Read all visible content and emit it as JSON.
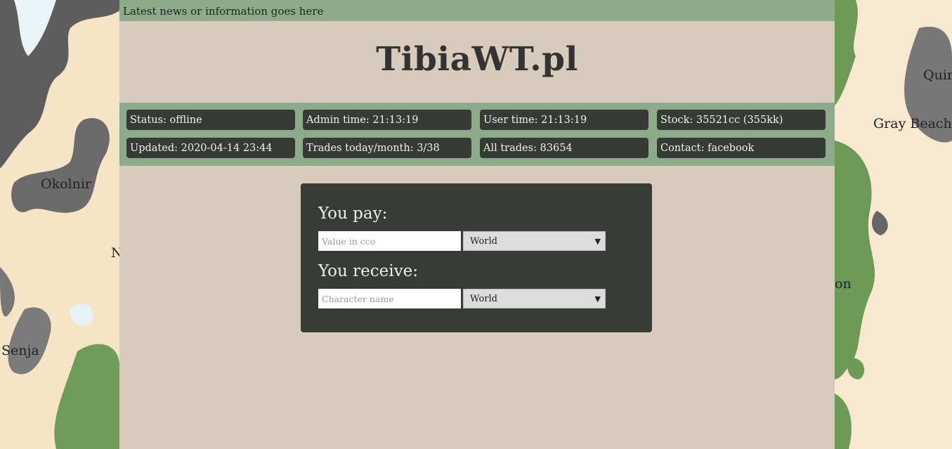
{
  "news": "Latest news or information goes here",
  "title": "TibiaWT.pl",
  "stats": [
    {
      "label": "Status: offline"
    },
    {
      "label": "Admin time: 21:13:19"
    },
    {
      "label": "User time: 21:13:19"
    },
    {
      "label": "Stock: 35521cc (355kk)"
    },
    {
      "label": "Updated: 2020-04-14 23:44"
    },
    {
      "label": "Trades today/month: 3/38"
    },
    {
      "label": "All trades: 83654"
    },
    {
      "label": "Contact: facebook"
    }
  ],
  "trade": {
    "pay_heading": "You pay:",
    "pay_placeholder": "Value in cco",
    "pay_world": "World",
    "receive_heading": "You receive:",
    "receive_placeholder": "Character name",
    "receive_world": "World"
  },
  "map_labels": {
    "left_1": "Okolnir",
    "left_2": "Senja",
    "left_3": "N",
    "right_1": "Quir",
    "right_2": "Gray Beach",
    "right_3": "on"
  }
}
